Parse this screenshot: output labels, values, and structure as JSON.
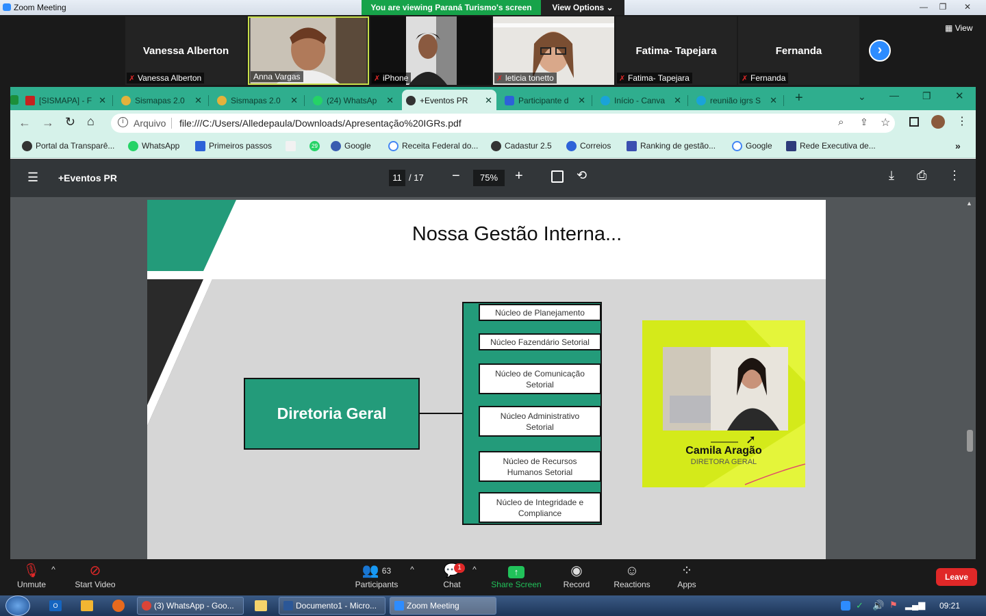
{
  "zoom": {
    "window_title": "Zoom Meeting",
    "viewing_banner": "You are viewing Paraná Turismo's screen",
    "view_options": "View Options",
    "view_label": "View",
    "participants": [
      {
        "name": "Vanessa Alberton",
        "label": "Vanessa Alberton",
        "video": false
      },
      {
        "name": "Anna Vargas",
        "label": "Anna Vargas",
        "video": true
      },
      {
        "name": "iPhone",
        "label": "iPhone",
        "video": true
      },
      {
        "name": "leticia tonetto",
        "label": "leticia tonetto",
        "video": true
      },
      {
        "name": "Fatima- Tapejara",
        "label": "Fatima- Tapejara",
        "video": false
      },
      {
        "name": "Fernanda",
        "label": "Fernanda",
        "video": false
      }
    ],
    "bottom": {
      "unmute": "Unmute",
      "start_video": "Start Video",
      "participants": "Participants",
      "participants_count": "63",
      "chat": "Chat",
      "chat_badge": "1",
      "share_screen": "Share Screen",
      "record": "Record",
      "reactions": "Reactions",
      "apps": "Apps",
      "leave": "Leave"
    }
  },
  "browser": {
    "tabs": [
      {
        "label": "[SISMAPA] - F",
        "active": false
      },
      {
        "label": "Sismapas 2.0",
        "active": false
      },
      {
        "label": "Sismapas 2.0",
        "active": false
      },
      {
        "label": "(24) WhatsAp",
        "active": false
      },
      {
        "label": "+Eventos PR",
        "active": true
      },
      {
        "label": "Participante d",
        "active": false
      },
      {
        "label": "Início - Canva",
        "active": false
      },
      {
        "label": "reunião igrs S",
        "active": false
      }
    ],
    "address_prefix": "Arquivo",
    "url": "file:///C:/Users/Alledepaula/Downloads/Apresentação%20IGRs.pdf",
    "bookmarks": [
      "Portal da Transparê...",
      "WhatsApp",
      "Primeiros passos",
      "",
      "",
      "Google",
      "Receita Federal do...",
      "Cadastur 2.5",
      "Correios",
      "Ranking de gestão...",
      "Google",
      "Rede Executiva de..."
    ],
    "bookmark_badge": "29"
  },
  "pdf": {
    "title": "+Eventos PR",
    "page_current": "11",
    "page_total": "/ 17",
    "zoom": "75%",
    "slide": {
      "heading": "Nossa Gestão Interna...",
      "root": "Diretoria Geral",
      "nodes": [
        "Núcleo de Planejamento",
        "Núcleo Fazendário Setorial",
        "Núcleo de Comunicação Setorial",
        "Núcleo Administrativo Setorial",
        "Núcleo de Recursos Humanos Setorial",
        "Núcleo de Integridade e Compliance"
      ],
      "card_name": "Camila Aragão",
      "card_role": "DIRETORA GERAL"
    }
  },
  "taskbar": {
    "items": [
      "(3) WhatsApp - Goo...",
      "Documento1 - Micro...",
      "Zoom Meeting"
    ],
    "clock": "09:21"
  }
}
